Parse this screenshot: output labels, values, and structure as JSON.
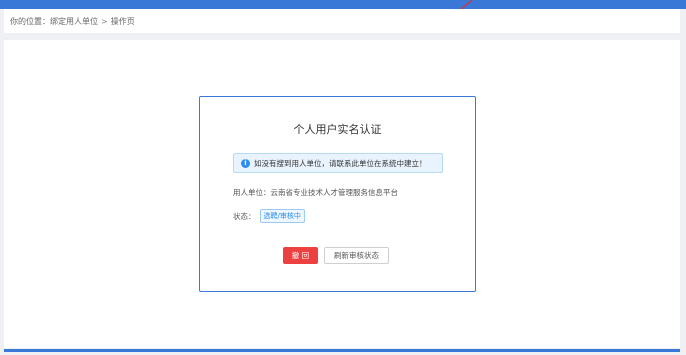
{
  "breadcrumb": {
    "prefix": "你的位置：",
    "parent": "绑定用人单位",
    "separator": ">",
    "current": "操作页"
  },
  "card": {
    "title": "个人用户实名认证",
    "notice": "如没有搜到用人单位，请联系此单位在系统中建立！",
    "employer_label": "用人单位：",
    "employer_value": "云南省专业技术人才管理服务信息平台",
    "status_label": "状态：",
    "status_value": "选聘/审核中",
    "withdraw_label": "撤 回",
    "refresh_label": "刷新审核状态"
  },
  "icons": {
    "notice": "info-circle-icon"
  },
  "colors": {
    "accent": "#3a78d8",
    "danger": "#ed4040",
    "info": "#2d8cf0",
    "annotation": "#e03030"
  }
}
